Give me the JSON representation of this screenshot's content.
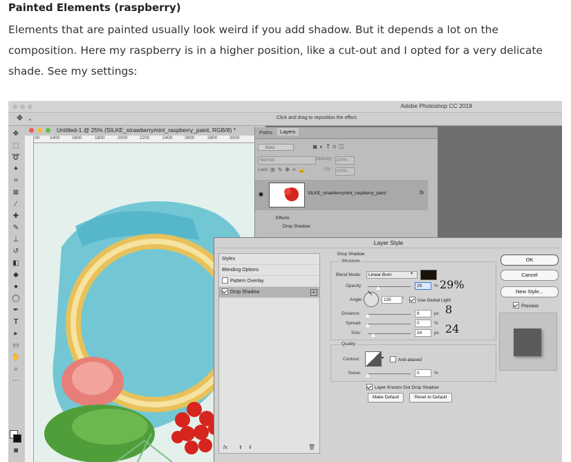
{
  "article": {
    "heading": "Painted Elements (raspberry)",
    "paragraph": "Elements that are painted usually look weird if you add shadow. But it depends a lot on the composition. Here my raspberry is in a higher position, like a cut-out and I opted for a very delicate shade. See my settings:"
  },
  "photoshop": {
    "app_title": "Adobe Photoshop CC 2019",
    "hint": "Click and drag to reposition the effect.",
    "document": {
      "title": "Untitled-1 @ 25% (SILKE_strawberrymint_raspberry_paint, RGB/8) *",
      "ruler_ticks": [
        "00",
        "1400",
        "1600",
        "1800",
        "2000",
        "2200",
        "2400",
        "2600",
        "2800",
        "3000"
      ]
    },
    "layers_panel": {
      "tabs": [
        "Paths",
        "Layers"
      ],
      "kind_label": "Kind",
      "blend_mode": "Normal",
      "opacity_label": "Opacity:",
      "opacity_value": "100%",
      "lock_label": "Lock:",
      "fill_label": "Fill:",
      "fill_value": "100%",
      "layer_name": "SILKE_strawberrymint_raspberry_paint",
      "fx_badge": "fx",
      "effects_label": "Effects",
      "drop_shadow_label": "Drop Shadow"
    },
    "layer_style": {
      "title": "Layer Style",
      "styles_list": [
        {
          "label": "Styles",
          "checkbox": false,
          "checked": false,
          "selected": false
        },
        {
          "label": "Blending Options",
          "checkbox": false,
          "checked": false,
          "selected": false
        },
        {
          "label": "Pattern Overlay",
          "checkbox": true,
          "checked": false,
          "selected": false
        },
        {
          "label": "Drop Shadow",
          "checkbox": true,
          "checked": true,
          "selected": true
        }
      ],
      "section_title": "Drop Shadow",
      "structure_label": "Structure",
      "blend_mode_label": "Blend Mode:",
      "blend_mode_value": "Linear Burn",
      "shadow_color": "#1a1209",
      "opacity_label": "Opacity:",
      "opacity_value": "29",
      "opacity_annotation": "29%",
      "angle_label": "Angle:",
      "angle_value": "135",
      "use_global_light": "Use Global Light",
      "distance_label": "Distance:",
      "distance_value": "8",
      "distance_annotation": "8",
      "spread_label": "Spread:",
      "spread_value": "0",
      "size_label": "Size:",
      "size_value": "24",
      "size_annotation": "24",
      "px_unit": "px",
      "pct_unit": "%",
      "quality_label": "Quality",
      "contour_label": "Contour:",
      "anti_aliased": "Anti-aliased",
      "noise_label": "Noise:",
      "noise_value": "0",
      "knocks_out": "Layer Knocks Out Drop Shadow",
      "make_default": "Make Default",
      "reset_default": "Reset to Default",
      "ok": "OK",
      "cancel": "Cancel",
      "new_style": "New Style...",
      "preview": "Preview",
      "fx_footer": "fx."
    }
  }
}
